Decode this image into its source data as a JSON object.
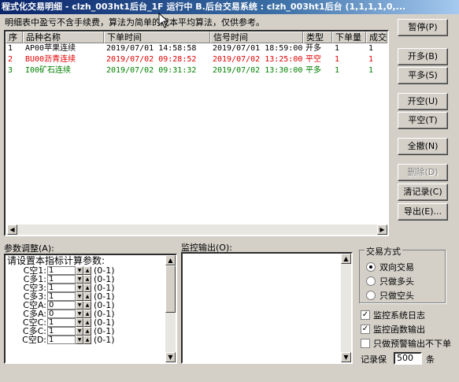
{
  "window": {
    "title": "程式化交易明细 - clzh_003ht1后台_1F 运行中  B.后台交易系统 : clzh_003ht1后台 (1,1,1,1,0,..."
  },
  "note": "明细表中盈亏不含手续费，算法为简单的成本平均算法，仅供参考。",
  "table": {
    "columns": [
      "序",
      "品种名称",
      "下单时间",
      "信号时间",
      "类型",
      "下单量",
      "成交"
    ],
    "rows": [
      {
        "cells": [
          "1",
          "AP00苹果连续",
          "2019/07/01 14:58:58",
          "2019/07/01 18:59:00",
          "开多",
          "1",
          "1"
        ],
        "color": "#000000"
      },
      {
        "cells": [
          "2",
          "BU00沥青连续",
          "2019/07/02 09:28:52",
          "2019/07/02 13:25:00",
          "平空",
          "1",
          "1"
        ],
        "color": "#e00000"
      },
      {
        "cells": [
          "3",
          "I00矿石连续",
          "2019/07/02 09:31:32",
          "2019/07/02 13:30:00",
          "平多",
          "1",
          "1"
        ],
        "color": "#008000"
      }
    ]
  },
  "buttons": {
    "pause": "暂停(P)",
    "open_long": "开多(B)",
    "close_long": "平多(S)",
    "open_short": "开空(U)",
    "close_short": "平空(T)",
    "close_all": "全撤(N)",
    "delete": "删除(D)",
    "clear_records": "清记录(C)",
    "export": "导出(E)..."
  },
  "params": {
    "section_label": "参数调整(A):",
    "title": "请设置本指标计算参数:",
    "items": [
      {
        "label": "C空1:",
        "value": "1",
        "range": "(0-1)"
      },
      {
        "label": "C多1:",
        "value": "1",
        "range": "(0-1)"
      },
      {
        "label": "C空3:",
        "value": "1",
        "range": "(0-1)"
      },
      {
        "label": "C多3:",
        "value": "1",
        "range": "(0-1)"
      },
      {
        "label": "C空A:",
        "value": "0",
        "range": "(0-1)"
      },
      {
        "label": "C多A:",
        "value": "0",
        "range": "(0-1)"
      },
      {
        "label": "C空C:",
        "value": "1",
        "range": "(0-1)"
      },
      {
        "label": "C多C:",
        "value": "1",
        "range": "(0-1)"
      },
      {
        "label": "C空D:",
        "value": "1",
        "range": "(0-1)"
      }
    ]
  },
  "monitor": {
    "label": "监控输出(O):"
  },
  "trade_mode": {
    "legend": "交易方式",
    "options": [
      {
        "label": "双向交易",
        "selected": true
      },
      {
        "label": "只做多头",
        "selected": false
      },
      {
        "label": "只做空头",
        "selected": false
      }
    ]
  },
  "checks": [
    {
      "label": "监控系统日志",
      "checked": true
    },
    {
      "label": "监控函数输出",
      "checked": true
    },
    {
      "label": "只做预警输出不下单",
      "checked": false
    }
  ],
  "record_keep": {
    "prefix": "记录保",
    "value": "500",
    "suffix": "条"
  },
  "icons": {
    "scroll_left": "scroll-left-arrow-icon",
    "scroll_right": "scroll-right-arrow-icon",
    "cursor": "mouse-cursor-icon"
  }
}
